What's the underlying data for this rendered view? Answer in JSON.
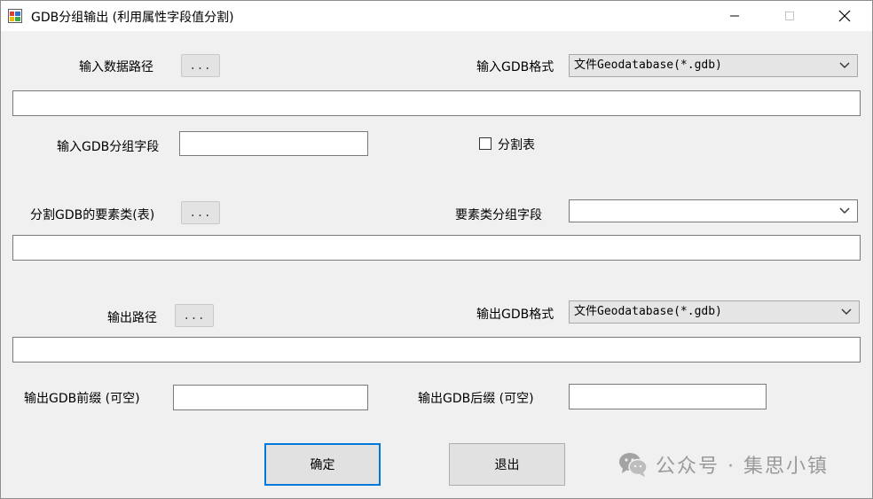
{
  "window": {
    "title": "GDB分组输出 (利用属性字段值分割)",
    "icons": [
      "app-icon",
      "minimize-icon",
      "maximize-icon",
      "close-icon"
    ]
  },
  "input": {
    "path_label": "输入数据路径",
    "browse_label": "...",
    "format_label": "输入GDB格式",
    "format_value": "文件Geodatabase(*.gdb)",
    "path_value": "",
    "group_field_label": "输入GDB分组字段",
    "group_field_value": "",
    "split_table_label": "分割表",
    "split_table_checked": false
  },
  "split": {
    "feature_class_label": "分割GDB的要素类(表)",
    "browse_label": "...",
    "group_field_label": "要素类分组字段",
    "group_field_value": "",
    "feature_class_value": ""
  },
  "output": {
    "path_label": "输出路径",
    "browse_label": "...",
    "format_label": "输出GDB格式",
    "format_value": "文件Geodatabase(*.gdb)",
    "path_value": "",
    "prefix_label": "输出GDB前缀 (可空)",
    "prefix_value": "",
    "suffix_label": "输出GDB后缀 (可空)",
    "suffix_value": ""
  },
  "actions": {
    "ok_label": "确定",
    "exit_label": "退出"
  },
  "watermark": {
    "text": "公众号 · 集思小镇",
    "icon": "wechat-icon"
  },
  "colors": {
    "focus_border": "#0078d7",
    "background": "#f0f0f0",
    "titlebar": "#ffffff"
  }
}
